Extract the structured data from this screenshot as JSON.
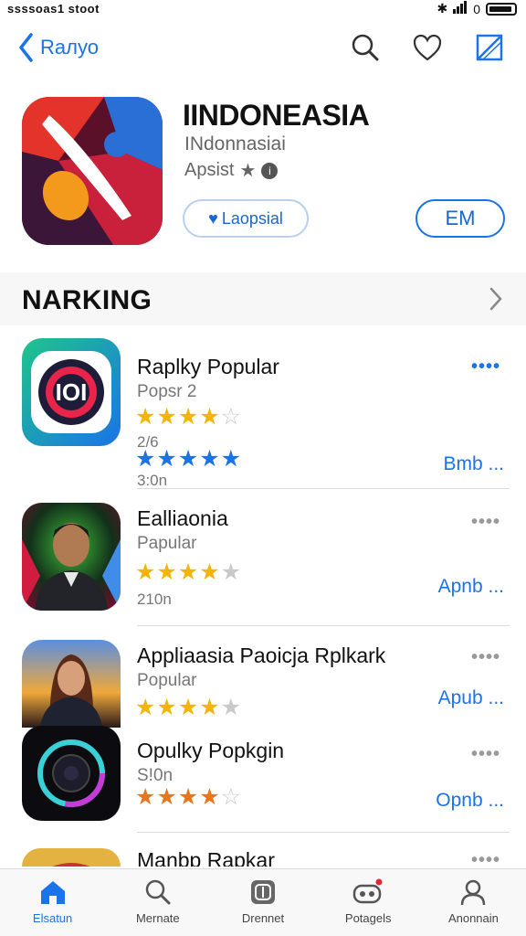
{
  "status_bar": {
    "left_text": "ssssoas1 stoot",
    "signal_text": "0"
  },
  "nav": {
    "back_label": "Rалуо"
  },
  "hero": {
    "title": "IINDONEASIA",
    "subtitle": "INdonnasiai",
    "rating_label": "Apsist",
    "loved_label": "Laopsial",
    "get_label": "EM"
  },
  "section": {
    "title": "NARKING"
  },
  "list": [
    {
      "name": "Raplky Popular",
      "meta": "Popsr 2",
      "meta2": "2/6",
      "meta3": "3:0n",
      "stars": 4,
      "stars2": 5,
      "action": "Bmb ...",
      "dots_blue": true
    },
    {
      "name": "Ealliaonia",
      "meta": "Papular",
      "meta2": "210n",
      "stars": 4,
      "action": "Apnb ..."
    },
    {
      "name": "Appliaasia Paoicja Rplkark",
      "meta": "Popular",
      "stars": 4,
      "action": "Apub ..."
    },
    {
      "name": "Opulky Popkgin",
      "meta": "S!0n",
      "stars": 4,
      "action": "Opnb ..."
    },
    {
      "name": "Manbp Rapkar"
    }
  ],
  "tabs": [
    {
      "label": "Elsatun",
      "icon": "home-icon"
    },
    {
      "label": "Mernate",
      "icon": "search-icon"
    },
    {
      "label": "Drennet",
      "icon": "apps-icon"
    },
    {
      "label": "Potagels",
      "icon": "games-icon"
    },
    {
      "label": "Anonnain",
      "icon": "profile-icon"
    }
  ],
  "colors": {
    "accent": "#1a73e8",
    "star": "#f4b400"
  }
}
